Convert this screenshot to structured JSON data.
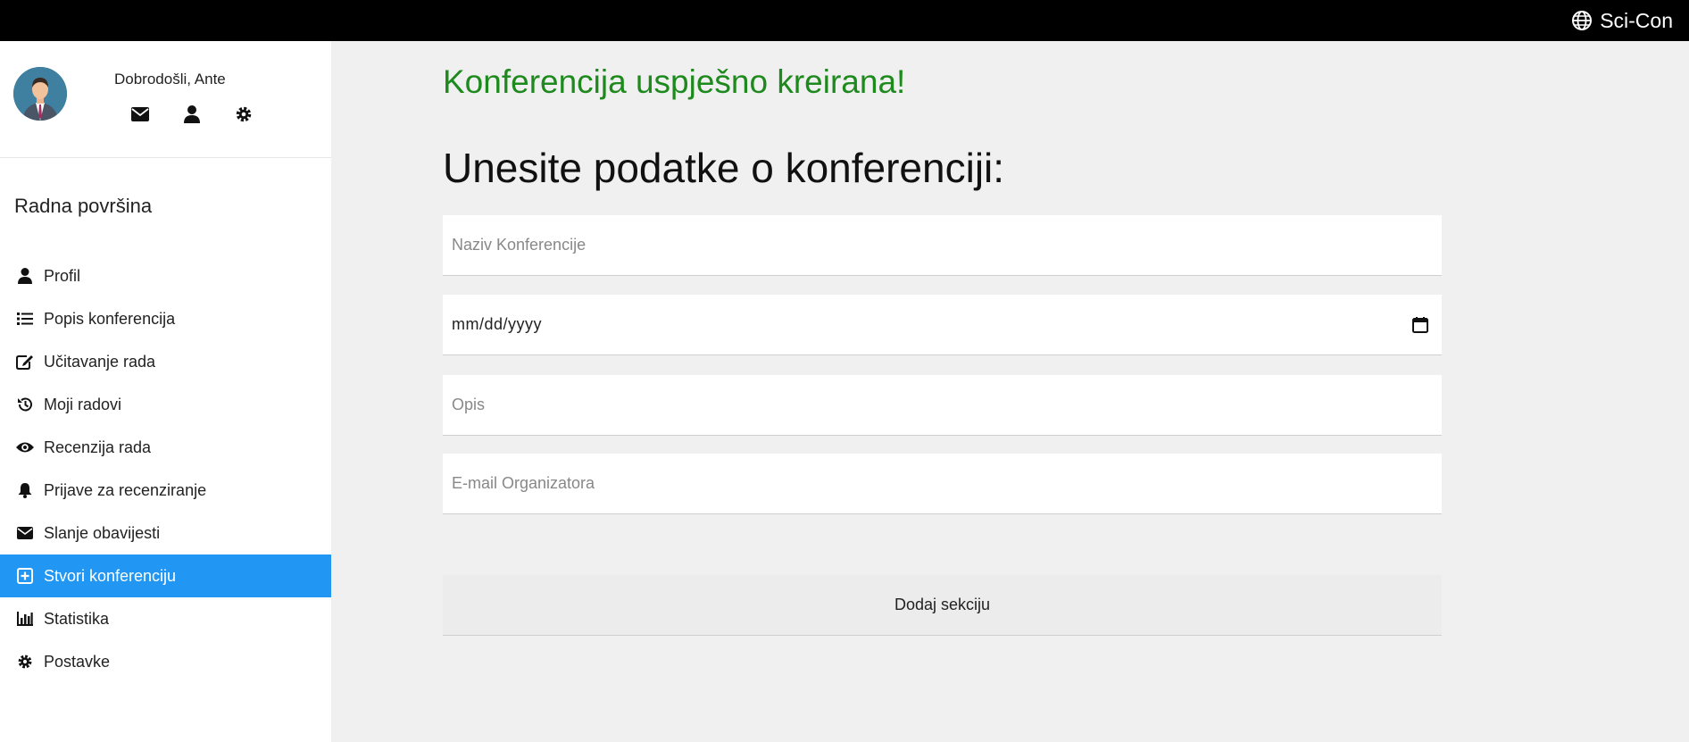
{
  "brand": {
    "name": "Sci-Con",
    "icon": "globe-icon"
  },
  "user": {
    "welcome": "Dobrodošli, Ante",
    "icons": [
      "envelope-icon",
      "user-icon",
      "gear-icon"
    ]
  },
  "sidebar": {
    "title": "Radna površina",
    "items": [
      {
        "label": "Profil",
        "icon": "user-icon"
      },
      {
        "label": "Popis konferencija",
        "icon": "list-icon"
      },
      {
        "label": "Učitavanje rada",
        "icon": "edit-icon"
      },
      {
        "label": "Moji radovi",
        "icon": "history-icon"
      },
      {
        "label": "Recenzija rada",
        "icon": "eye-icon"
      },
      {
        "label": "Prijave za recenziranje",
        "icon": "bell-icon"
      },
      {
        "label": "Slanje obavijesti",
        "icon": "envelope-icon"
      },
      {
        "label": "Stvori konferenciju",
        "icon": "plus-square-icon",
        "active": true
      },
      {
        "label": "Statistika",
        "icon": "bar-chart-icon"
      },
      {
        "label": "Postavke",
        "icon": "gear-icon"
      }
    ]
  },
  "main": {
    "success": "Konferencija uspješno kreirana!",
    "title": "Unesite podatke o konferenciji:",
    "fields": {
      "name_placeholder": "Naziv Konferencije",
      "date_value": "mm/dd/yyyy",
      "description_placeholder": "Opis",
      "email_placeholder": "E-mail Organizatora"
    },
    "add_section_label": "Dodaj sekciju"
  },
  "colors": {
    "active": "#2196f3",
    "success": "#1e8a1e",
    "topbar": "#000000"
  }
}
